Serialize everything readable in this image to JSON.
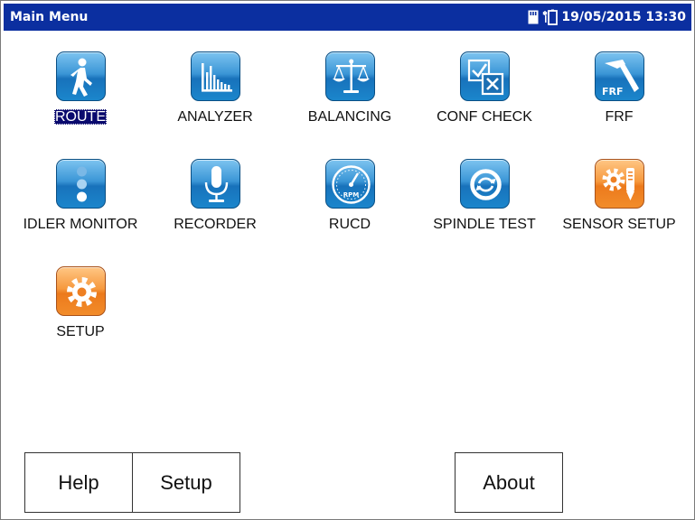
{
  "titlebar": {
    "title": "Main Menu",
    "datetime": "19/05/2015 13:30",
    "icons": [
      "memory-card-icon",
      "battery-icon"
    ]
  },
  "apps": [
    {
      "label": "ROUTE",
      "icon": "walking-person-icon",
      "color": "blue",
      "selected": true
    },
    {
      "label": "ANALYZER",
      "icon": "spectrum-bars-icon",
      "color": "blue"
    },
    {
      "label": "BALANCING",
      "icon": "balance-scale-icon",
      "color": "blue"
    },
    {
      "label": "CONF CHECK",
      "icon": "checkbox-icon",
      "color": "blue"
    },
    {
      "label": "FRF",
      "icon": "hammer-frf-icon",
      "color": "blue",
      "icon_text": "FRF"
    },
    {
      "label": "IDLER MONITOR",
      "icon": "idler-rollers-icon",
      "color": "blue"
    },
    {
      "label": "RECORDER",
      "icon": "microphone-icon",
      "color": "blue"
    },
    {
      "label": "RUCD",
      "icon": "rpm-gauge-icon",
      "color": "blue",
      "icon_text": "RPM"
    },
    {
      "label": "SPINDLE TEST",
      "icon": "spindle-icon",
      "color": "blue"
    },
    {
      "label": "SENSOR SETUP",
      "icon": "gear-sensor-icon",
      "color": "orange"
    },
    {
      "label": "SETUP",
      "icon": "gear-icon",
      "color": "orange"
    }
  ],
  "buttons": {
    "help": "Help",
    "setup": "Setup",
    "about": "About"
  },
  "colors": {
    "titlebar": "#0b2fa0",
    "icon_blue": "#1872bb",
    "icon_orange": "#ec7a1c",
    "selection": "#0a0a6e"
  }
}
